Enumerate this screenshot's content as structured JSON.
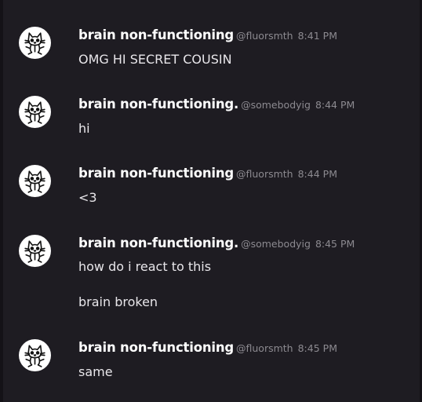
{
  "messages": [
    {
      "name": "brain non-functioning",
      "handle": "@fluorsmth",
      "time": "8:41 PM",
      "lines": [
        "OMG HI SECRET COUSIN"
      ]
    },
    {
      "name": "brain non-functioning.",
      "handle": "@somebodyig",
      "time": "8:44 PM",
      "lines": [
        "hi"
      ]
    },
    {
      "name": "brain non-functioning",
      "handle": "@fluorsmth",
      "time": "8:44 PM",
      "lines": [
        "<3"
      ]
    },
    {
      "name": "brain non-functioning.",
      "handle": "@somebodyig",
      "time": "8:45 PM",
      "lines": [
        "how do i react to this",
        "brain broken"
      ]
    },
    {
      "name": "brain non-functioning",
      "handle": "@fluorsmth",
      "time": "8:45 PM",
      "lines": [
        "same"
      ]
    }
  ],
  "avatar_icon": "cat-doodle-icon",
  "colors": {
    "background": "#1e1c22",
    "name": "#ffffff",
    "meta": "#8c8a90",
    "text": "#e8e6ea"
  }
}
